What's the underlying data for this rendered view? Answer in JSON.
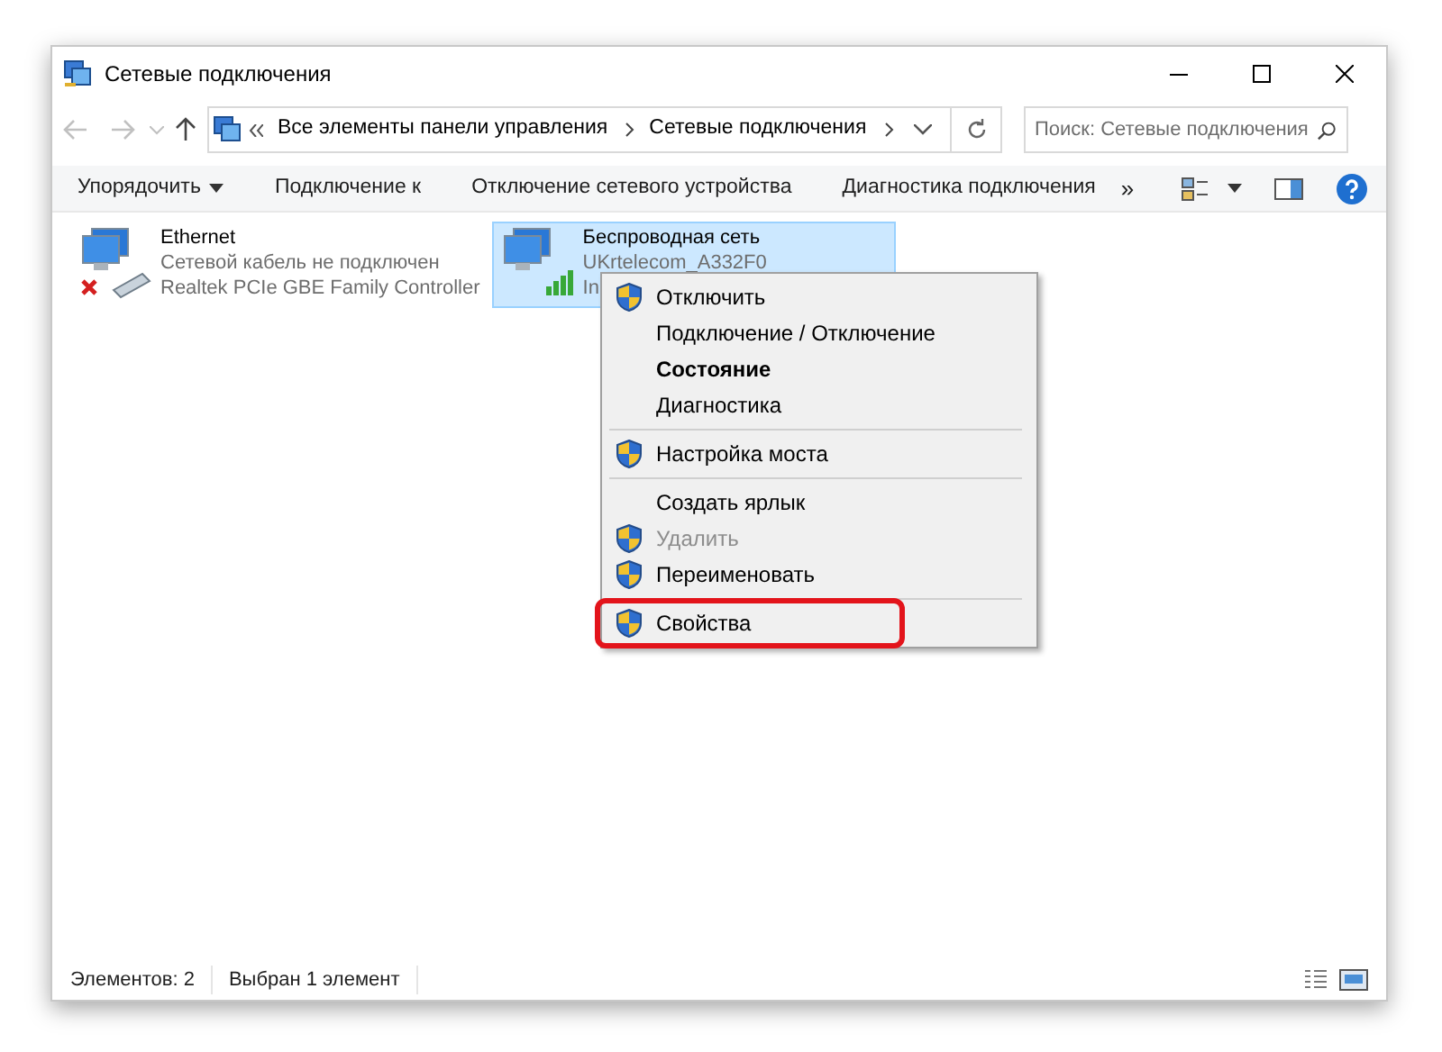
{
  "window": {
    "title": "Сетевые подключения"
  },
  "address": {
    "crumbs": [
      "Все элементы панели управления",
      "Сетевые подключения"
    ]
  },
  "search": {
    "placeholder": "Поиск: Сетевые подключения"
  },
  "toolbar": {
    "items": [
      {
        "label": "Упорядочить",
        "dropdown": true
      },
      {
        "label": "Подключение к",
        "dropdown": false
      },
      {
        "label": "Отключение сетевого устройства",
        "dropdown": false
      },
      {
        "label": "Диагностика подключения",
        "dropdown": false
      }
    ],
    "more": "»"
  },
  "connections": [
    {
      "name": "Ethernet",
      "status": "Сетевой кабель не подключен",
      "device": "Realtek PCIe GBE Family Controller",
      "selected": false,
      "kind": "wired"
    },
    {
      "name": "Беспроводная сеть",
      "status": "UKrtelecom_A332F0",
      "device": "In",
      "selected": true,
      "kind": "wireless"
    }
  ],
  "context_menu": {
    "items": [
      {
        "kind": "item",
        "label": "Отключить",
        "shield": true,
        "bold": false,
        "disabled": false,
        "highlighted": false
      },
      {
        "kind": "item",
        "label": "Подключение / Отключение",
        "shield": false,
        "bold": false,
        "disabled": false,
        "highlighted": false
      },
      {
        "kind": "item",
        "label": "Состояние",
        "shield": false,
        "bold": true,
        "disabled": false,
        "highlighted": false
      },
      {
        "kind": "item",
        "label": "Диагностика",
        "shield": false,
        "bold": false,
        "disabled": false,
        "highlighted": false
      },
      {
        "kind": "separator"
      },
      {
        "kind": "item",
        "label": "Настройка моста",
        "shield": true,
        "bold": false,
        "disabled": false,
        "highlighted": false
      },
      {
        "kind": "separator"
      },
      {
        "kind": "item",
        "label": "Создать ярлык",
        "shield": false,
        "bold": false,
        "disabled": false,
        "highlighted": false
      },
      {
        "kind": "item",
        "label": "Удалить",
        "shield": true,
        "bold": false,
        "disabled": true,
        "highlighted": false
      },
      {
        "kind": "item",
        "label": "Переименовать",
        "shield": true,
        "bold": false,
        "disabled": false,
        "highlighted": false
      },
      {
        "kind": "separator"
      },
      {
        "kind": "item",
        "label": "Свойства",
        "shield": true,
        "bold": false,
        "disabled": false,
        "highlighted": true
      }
    ]
  },
  "status_bar": {
    "texts": [
      "Элементов: 2",
      "Выбран 1 элемент"
    ]
  }
}
